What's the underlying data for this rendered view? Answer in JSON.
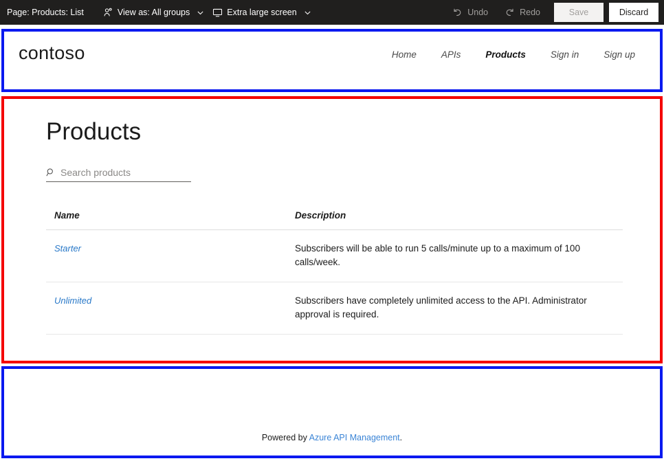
{
  "toolbar": {
    "page_label": "Page: Products: List",
    "view_as": {
      "icon": "people-icon",
      "label": "View as: All groups",
      "chevron": "chevron-down-icon"
    },
    "screen_size": {
      "icon": "monitor-icon",
      "label": "Extra large screen",
      "chevron": "chevron-down-icon"
    },
    "undo": {
      "icon": "undo-arrow-icon",
      "label": "Undo"
    },
    "redo": {
      "icon": "redo-arrow-icon",
      "label": "Redo"
    },
    "save_label": "Save",
    "discard_label": "Discard",
    "bg_color": "#201f1e",
    "disabled_color": "#a19f9d"
  },
  "outlines": {
    "header_box_color": "#0a19f0",
    "main_box_color": "#f40000",
    "footer_box_color": "#0a19f0"
  },
  "site_header": {
    "brand": "contoso",
    "nav": [
      {
        "label": "Home",
        "active": false
      },
      {
        "label": "APIs",
        "active": false
      },
      {
        "label": "Products",
        "active": true
      },
      {
        "label": "Sign in",
        "active": false
      },
      {
        "label": "Sign up",
        "active": false
      }
    ]
  },
  "main": {
    "title": "Products",
    "search": {
      "icon": "search-icon",
      "placeholder": "Search products",
      "value": ""
    },
    "table": {
      "columns": [
        "Name",
        "Description"
      ],
      "rows": [
        {
          "name": "Starter",
          "description": "Subscribers will be able to run 5 calls/minute up to a maximum of 100 calls/week."
        },
        {
          "name": "Unlimited",
          "description": "Subscribers have completely unlimited access to the API. Administrator approval is required."
        }
      ]
    },
    "link_color": "#2878c8"
  },
  "site_footer": {
    "powered_by_prefix": "Powered by ",
    "link_label": "Azure API Management",
    "suffix": ".",
    "link_color": "#3a84d6"
  }
}
